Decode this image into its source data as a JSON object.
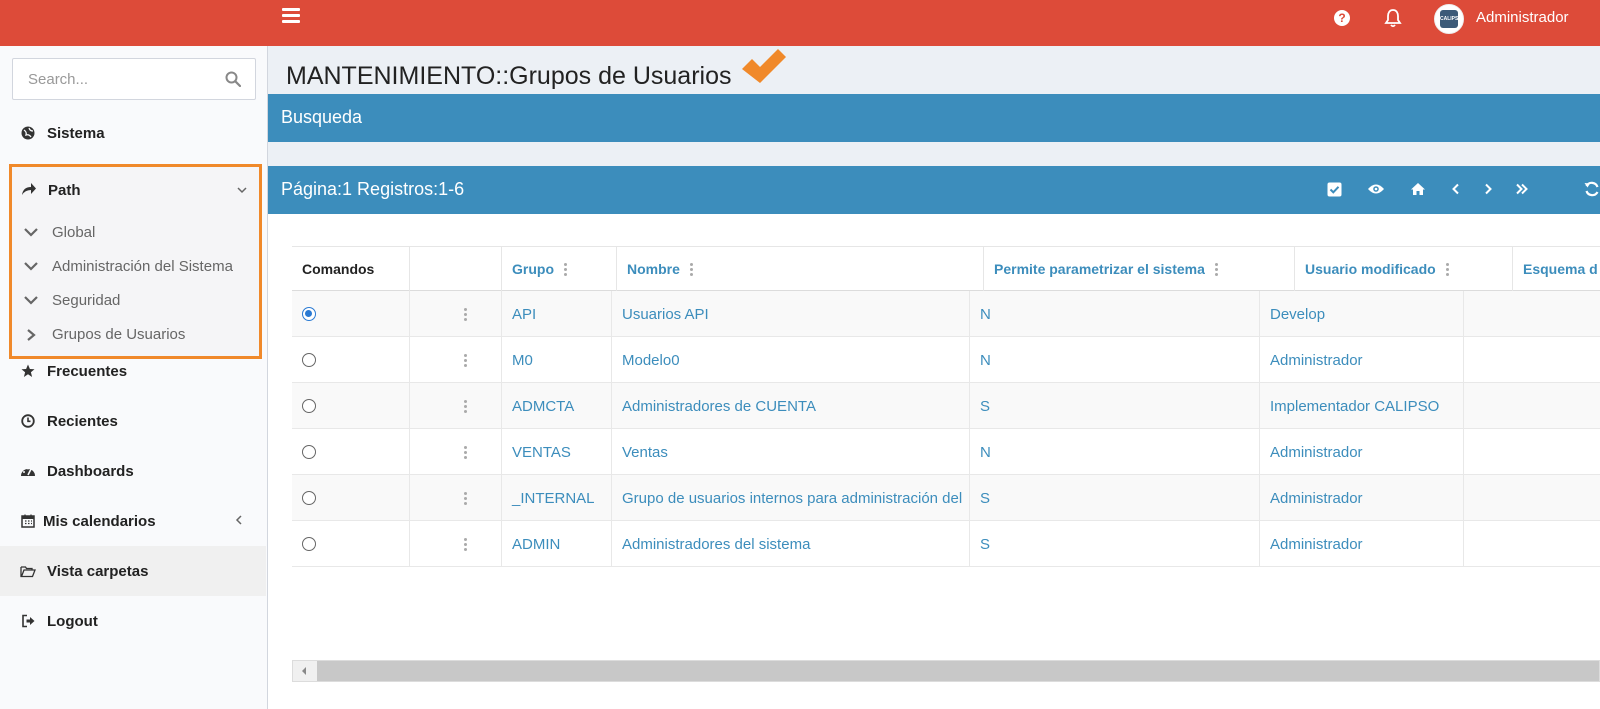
{
  "topbar": {
    "user_name": "Administrador",
    "help_label": "?",
    "avatar_text": "CALIPSO"
  },
  "search": {
    "placeholder": "Search..."
  },
  "sidebar": {
    "items": [
      {
        "label": "Sistema",
        "icon": "globe-icon"
      },
      {
        "label": "Path",
        "icon": "share-arrow-icon"
      },
      {
        "label": "Frecuentes",
        "icon": "star-icon"
      },
      {
        "label": "Recientes",
        "icon": "clock-icon"
      },
      {
        "label": "Dashboards",
        "icon": "dashboard-icon"
      },
      {
        "label": "Mis calendarios",
        "icon": "calendar-icon"
      },
      {
        "label": "Vista carpetas",
        "icon": "folder-open-icon"
      },
      {
        "label": "Logout",
        "icon": "sign-out-icon"
      }
    ],
    "path_children": [
      {
        "label": "Global"
      },
      {
        "label": "Administración del Sistema"
      },
      {
        "label": "Seguridad"
      },
      {
        "label": "Grupos de Usuarios"
      }
    ]
  },
  "main": {
    "page_title": "MANTENIMIENTO::Grupos de Usuarios",
    "search_box_title": "Busqueda",
    "results_title": "Página:1 Registros:1-6",
    "toolbar_icons": [
      "check-square-icon",
      "eye-icon",
      "home-icon",
      "chevron-left-icon",
      "chevron-right-icon",
      "double-chevron-right-icon",
      "refresh-icon"
    ]
  },
  "grid": {
    "columns": [
      "Comandos",
      "",
      "Grupo",
      "Nombre",
      "Permite parametrizar el sistema",
      "Usuario modificado",
      "Esquema d"
    ],
    "rows": [
      {
        "selected": true,
        "grupo": "API",
        "nombre": "Usuarios API",
        "permite": "N",
        "usuario": "Develop"
      },
      {
        "selected": false,
        "grupo": "M0",
        "nombre": "Modelo0",
        "permite": "N",
        "usuario": "Administrador"
      },
      {
        "selected": false,
        "grupo": "ADMCTA",
        "nombre": "Administradores de CUENTA",
        "permite": "S",
        "usuario": "Implementador CALIPSO"
      },
      {
        "selected": false,
        "grupo": "VENTAS",
        "nombre": "Ventas",
        "permite": "N",
        "usuario": "Administrador"
      },
      {
        "selected": false,
        "grupo": "_INTERNAL",
        "nombre": "Grupo de usuarios internos para administración del",
        "permite": "S",
        "usuario": "Administrador"
      },
      {
        "selected": false,
        "grupo": "ADMIN",
        "nombre": "Administradores del sistema",
        "permite": "S",
        "usuario": "Administrador"
      }
    ]
  },
  "colors": {
    "topbar": "#dd4b39",
    "box_header": "#3c8dbc",
    "highlight_border": "#f0892a",
    "radio_selected": "#2a7ad3"
  }
}
